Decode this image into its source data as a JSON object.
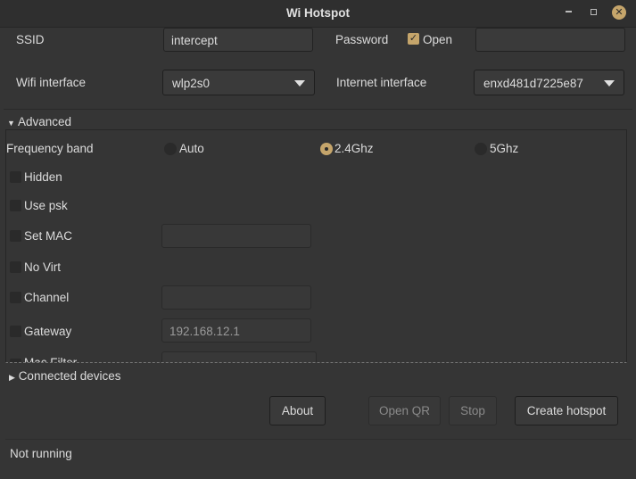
{
  "window": {
    "title": "Wi Hotspot"
  },
  "form": {
    "ssid_label": "SSID",
    "ssid_value": "intercept",
    "password_label": "Password",
    "open_label": "Open",
    "open_checked": true,
    "password_value": "",
    "wifi_label": "Wifi interface",
    "wifi_value": "wlp2s0",
    "internet_label": "Internet interface",
    "internet_value": "enxd481d7225e87"
  },
  "advanced": {
    "label": "Advanced",
    "expanded": true,
    "freq_label": "Frequency band",
    "freq_options": [
      "Auto",
      "2.4Ghz",
      "5Ghz"
    ],
    "freq_selected": "2.4Ghz",
    "hidden": "Hidden",
    "use_psk": "Use psk",
    "set_mac": "Set MAC",
    "no_virt": "No Virt",
    "channel": "Channel",
    "gateway": "Gateway",
    "gateway_placeholder": "192.168.12.1",
    "mac_filter": "Mac Filter"
  },
  "connected": {
    "label": "Connected devices",
    "expanded": false
  },
  "buttons": {
    "about": "About",
    "open_qr": "Open QR",
    "stop": "Stop",
    "create": "Create hotspot"
  },
  "status": "Not running",
  "colors": {
    "accent": "#c5a56b",
    "background": "#353535"
  }
}
